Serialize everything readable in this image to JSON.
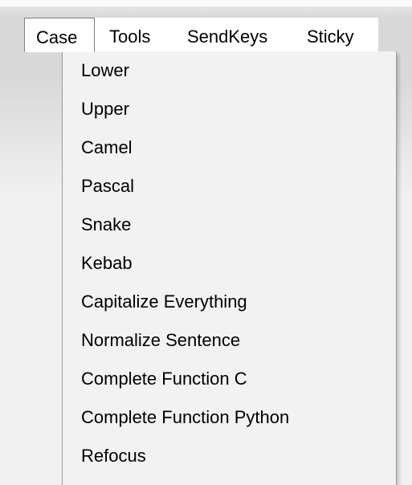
{
  "menubar": {
    "items": [
      {
        "label": "Case",
        "active": true
      },
      {
        "label": "Tools",
        "active": false
      },
      {
        "label": "SendKeys",
        "active": false
      },
      {
        "label": "Sticky",
        "active": false
      }
    ]
  },
  "case_menu": {
    "items": [
      {
        "label": "Lower"
      },
      {
        "label": "Upper"
      },
      {
        "label": "Camel"
      },
      {
        "label": "Pascal"
      },
      {
        "label": "Snake"
      },
      {
        "label": "Kebab"
      },
      {
        "label": "Capitalize Everything"
      },
      {
        "label": "Normalize Sentence"
      },
      {
        "label": "Complete Function C"
      },
      {
        "label": "Complete Function Python"
      },
      {
        "label": "Refocus"
      }
    ]
  }
}
